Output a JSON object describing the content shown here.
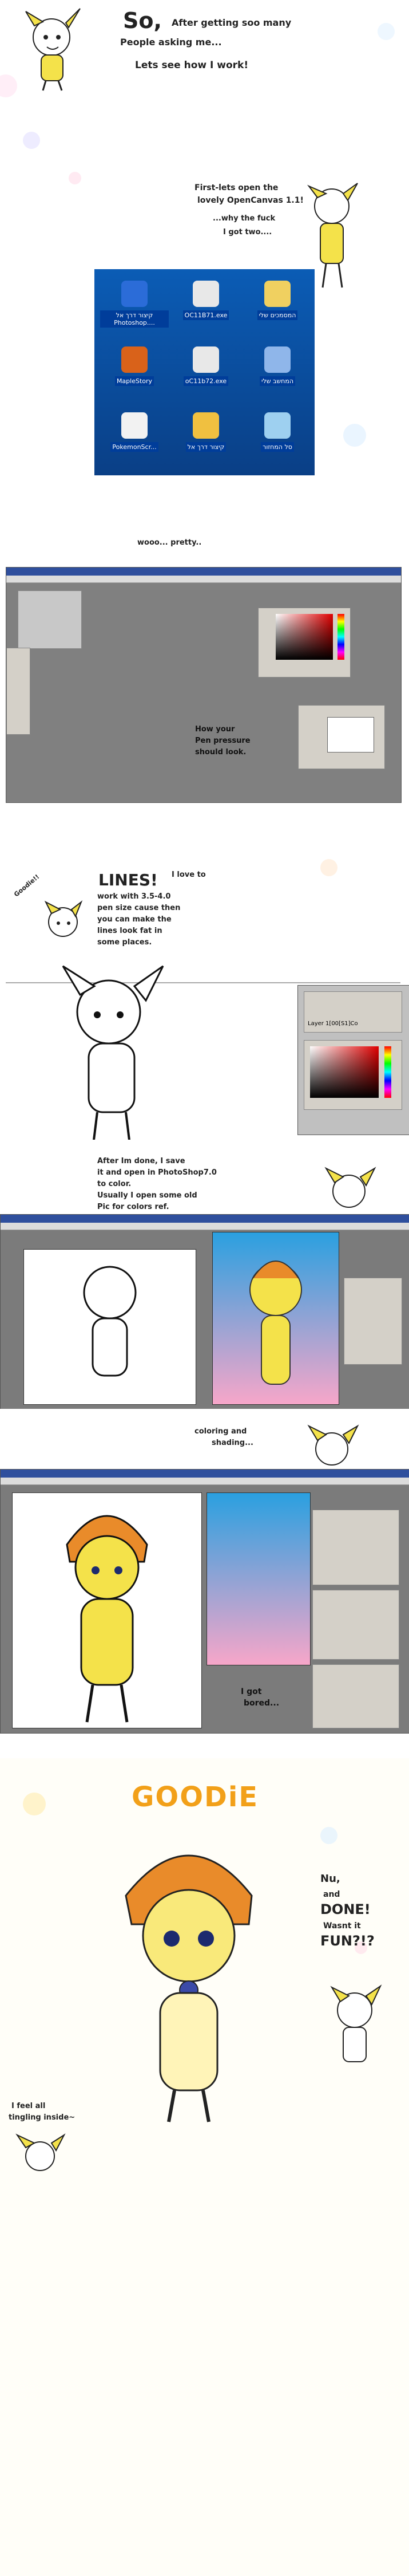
{
  "panels": {
    "intro": {
      "heading": "So,",
      "line1": "After getting soo many",
      "line2": "People asking me...",
      "line3": "Lets see how I work!"
    },
    "desktop": {
      "note_line1": "First-lets open the",
      "note_line2": "lovely OpenCanvas 1.1!",
      "note_line3": "...why the fuck",
      "note_line4": "I got two....",
      "icons": [
        {
          "label": "קיצור דרך אל Photoshop....",
          "icon": "photoshop-shortcut-icon"
        },
        {
          "label": "OC11B71.exe",
          "icon": "opencanvas-icon"
        },
        {
          "label": "המסמכים שלי",
          "icon": "my-documents-icon"
        },
        {
          "label": "MapleStory",
          "icon": "maplestory-icon"
        },
        {
          "label": "oC11b72.exe",
          "icon": "opencanvas-icon"
        },
        {
          "label": "המחשב שלי",
          "icon": "my-computer-icon"
        },
        {
          "label": "PokemonScr...",
          "icon": "pokemon-icon"
        },
        {
          "label": "קיצור דרך אל",
          "icon": "shortcut-icon"
        },
        {
          "label": "סל המחזור",
          "icon": "recycle-bin-icon"
        }
      ]
    },
    "opencanvas": {
      "comment": "wooo... pretty..",
      "pressure_note_1": "How your",
      "pressure_note_2": "Pen pressure",
      "pressure_note_3": "should look."
    },
    "lines": {
      "heading": "LINES!",
      "line1": "I love to",
      "line2": "work with 3.5-4.0",
      "line3": "pen size cause then",
      "line4": "you can make the",
      "line5": "lines look fat in",
      "line6": "some places.",
      "side": "Goodie!!",
      "layer_label": "Layer 1[00[S1]Co"
    },
    "photoshop_open": {
      "line1": "After Im done, I save",
      "line2": "it and open in PhotoShop7.0",
      "line3": "to color.",
      "line4": "Usually I open some old",
      "line5": "Pic for colors ref."
    },
    "coloring": {
      "comment1": "coloring and",
      "comment2": "shading...",
      "bored1": "I got",
      "bored2": "bored..."
    },
    "finale": {
      "title": "GOODiE",
      "exclaim1": "Nu,",
      "exclaim2": "and",
      "exclaim3": "DONE!",
      "exclaim4": "Wasnt it",
      "exclaim5": "FUN?!?",
      "feel1": "I feel all",
      "feel2": "tingling inside~"
    }
  },
  "colors": {
    "desktop_blue": "#0a58a8",
    "ps_gray": "#7b7b7b",
    "char_yellow": "#f4e24a",
    "char_orange": "#e98b2a",
    "bg_pink": "#f3a6c4",
    "bg_blue": "#3aa6e6"
  }
}
